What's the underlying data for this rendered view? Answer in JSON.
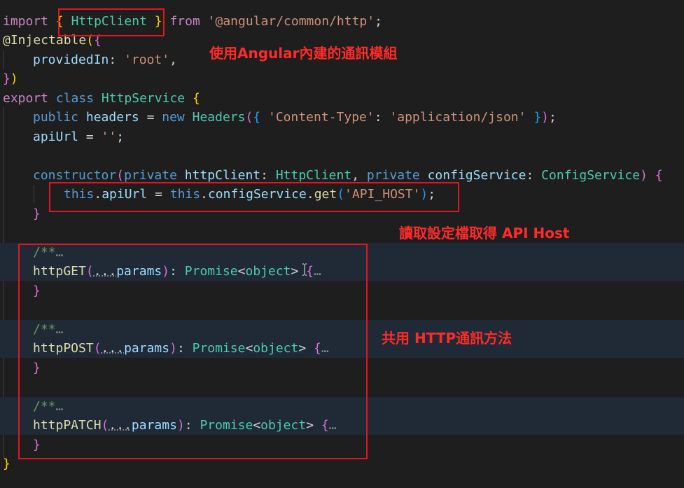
{
  "editor": {
    "lines": {
      "import": {
        "kw": "import",
        "lb": "{",
        "cls": "HttpClient",
        "rb": "}",
        "from": "from",
        "mod": "'@angular/common/http'",
        "semi": ";"
      },
      "decorator": {
        "at": "@",
        "name": "Injectable",
        "open": "(",
        "brace": "{"
      },
      "provided_in": {
        "key": "providedIn",
        "colon": ": ",
        "val": "'root'",
        "comma": ","
      },
      "decorator_end": {
        "brace": "}",
        "paren": ")"
      },
      "class_decl": {
        "export": "export",
        "class": "class",
        "name": "HttpService",
        "brace": "{"
      },
      "headers": {
        "public": "public",
        "name": "headers",
        "eq": " = ",
        "new": "new",
        "type": "Headers",
        "open": "(",
        "lb": "{",
        "key": "'Content-Type'",
        "colon": ": ",
        "val": "'application/json'",
        "rb": "}",
        "close": ")",
        "semi": ";"
      },
      "api_url": {
        "name": "apiUrl",
        "eq": " = ",
        "val": "''",
        "semi": ";"
      },
      "ctor": {
        "kw": "constructor",
        "open": "(",
        "priv1": "private",
        "p1": "httpClient",
        "c1": ": ",
        "t1": "HttpClient",
        "comma": ", ",
        "priv2": "private",
        "p2": "configService",
        "c2": ": ",
        "t2": "ConfigService",
        "close": ")",
        "brace": "{"
      },
      "ctor_body": {
        "this1": "this",
        "dot1": ".",
        "prop": "apiUrl",
        "eq": " = ",
        "this2": "this",
        "dot2": ".",
        "obj": "configService",
        "dot3": ".",
        "fn": "get",
        "open": "(",
        "arg": "'API_HOST'",
        "close": ")",
        "semi": ";"
      },
      "ctor_end": {
        "brace": "}"
      },
      "doc1": {
        "text": "/**",
        "ell": "…"
      },
      "get_sig": {
        "name": "httpGET",
        "open": "(",
        "spread": "...",
        "param": "params",
        "close": ")",
        "colon": ": ",
        "type": "Promise",
        "lt": "<",
        "gen": "object",
        "gt": ">",
        "brace": "{",
        "ell": "…"
      },
      "get_end": {
        "brace": "}"
      },
      "doc2": {
        "text": "/**",
        "ell": "…"
      },
      "post_sig": {
        "name": "httpPOST",
        "open": "(",
        "spread": "...",
        "param": "params",
        "close": ")",
        "colon": ": ",
        "type": "Promise",
        "lt": "<",
        "gen": "object",
        "gt": ">",
        "brace": "{",
        "ell": "…"
      },
      "post_end": {
        "brace": "}"
      },
      "doc3": {
        "text": "/**",
        "ell": "…"
      },
      "patch_sig": {
        "name": "httpPATCH",
        "open": "(",
        "spread": "...",
        "param": "params",
        "close": ")",
        "colon": ": ",
        "type": "Promise",
        "lt": "<",
        "gen": "object",
        "gt": ">",
        "brace": "{",
        "ell": "…"
      },
      "patch_end": {
        "brace": "}"
      },
      "class_end": {
        "brace": "}"
      }
    }
  },
  "annotations": {
    "builtin": "使用Angular內建的通訊模組",
    "config": "讀取設定檔取得 API Host",
    "shared": "共用 HTTP通訊方法"
  },
  "colors": {
    "background": "#1e1e1e",
    "folded_background": "#1f2a36",
    "annotation_red": "#e5141f"
  },
  "icons": {
    "mouse_cursor": "text-cursor-icon"
  }
}
